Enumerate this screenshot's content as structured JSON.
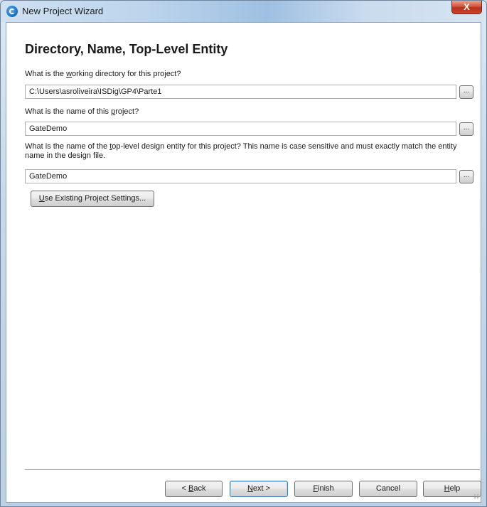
{
  "window": {
    "title": "New Project Wizard",
    "close_label": "X"
  },
  "page": {
    "heading": "Directory, Name, Top-Level Entity"
  },
  "fields": {
    "directory": {
      "pre": "What is the ",
      "key": "w",
      "post": "orking directory for this project?",
      "value": "C:\\Users\\asroliveira\\ISDig\\GP4\\Parte1"
    },
    "name": {
      "pre": "What is the name of this ",
      "key": "p",
      "post": "roject?",
      "value": "GateDemo"
    },
    "entity": {
      "pre": "What is the name of the ",
      "key": "t",
      "post": "op-level design entity for this project? This name is case sensitive and must exactly match the entity name in the design file.",
      "value": "GateDemo"
    },
    "browse_label": "..."
  },
  "use_existing": {
    "key": "U",
    "rest": "se Existing Project Settings..."
  },
  "buttons": {
    "back": {
      "pre": "< ",
      "key": "B",
      "rest": "ack"
    },
    "next": {
      "pre": "",
      "key": "N",
      "rest": "ext >"
    },
    "finish": {
      "pre": "",
      "key": "F",
      "rest": "inish"
    },
    "cancel": {
      "label": "Cancel"
    },
    "help": {
      "pre": "",
      "key": "H",
      "rest": "elp"
    }
  }
}
